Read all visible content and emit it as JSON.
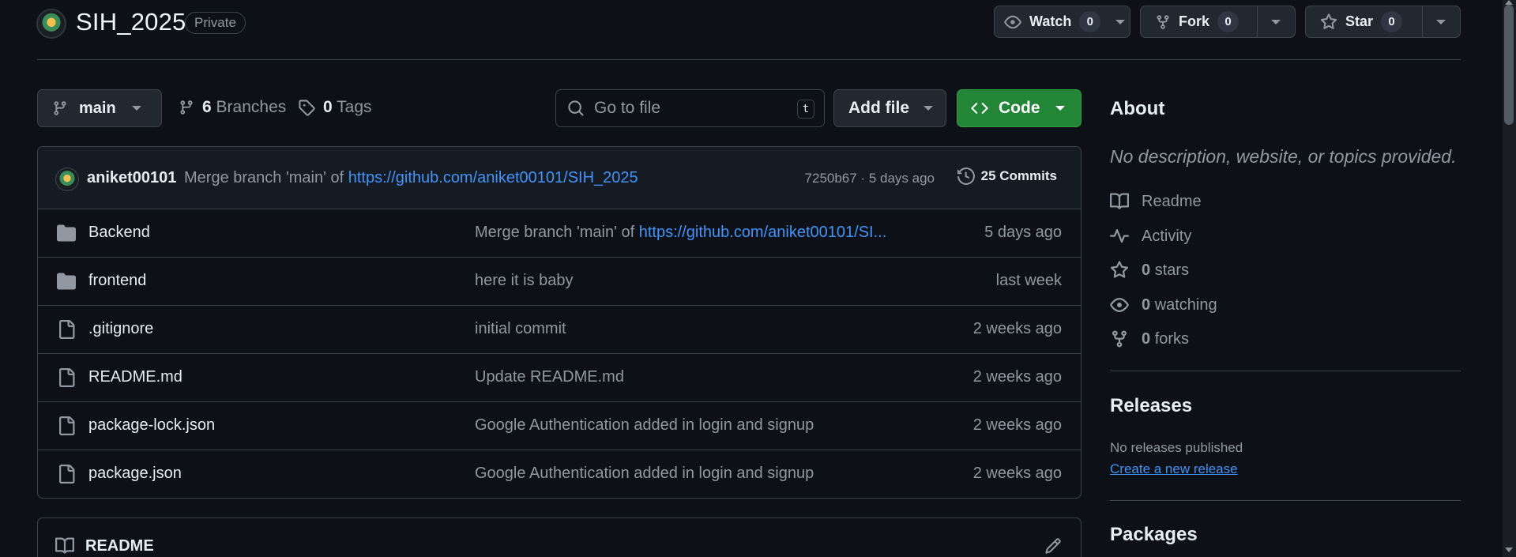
{
  "repo": {
    "name": "SIH_2025",
    "visibility": "Private"
  },
  "header": {
    "watch": {
      "label": "Watch",
      "count": "0"
    },
    "fork": {
      "label": "Fork",
      "count": "0"
    },
    "star": {
      "label": "Star",
      "count": "0"
    }
  },
  "toolbar": {
    "branch": "main",
    "branches_count": "6",
    "branches_label": "Branches",
    "tags_count": "0",
    "tags_label": "Tags",
    "goto_placeholder": "Go to file",
    "goto_shortcut": "t",
    "add_file_label": "Add file",
    "code_label": "Code"
  },
  "latest_commit": {
    "author": "aniket00101",
    "message_prefix": "Merge branch 'main' of ",
    "message_link": "https://github.com/aniket00101/SIH_2025",
    "sha_time": "7250b67 · 5 days ago",
    "commits_count": "25",
    "commits_label": "Commits"
  },
  "files": [
    {
      "type": "folder",
      "name": "Backend",
      "message": "Merge branch 'main' of ",
      "message_link": "https://github.com/aniket00101/SI...",
      "time": "5 days ago"
    },
    {
      "type": "folder",
      "name": "frontend",
      "message": "here it is baby",
      "message_link": "",
      "time": "last week"
    },
    {
      "type": "file",
      "name": ".gitignore",
      "message": "initial commit",
      "message_link": "",
      "time": "2 weeks ago"
    },
    {
      "type": "file",
      "name": "README.md",
      "message": "Update README.md",
      "message_link": "",
      "time": "2 weeks ago"
    },
    {
      "type": "file",
      "name": "package-lock.json",
      "message": "Google Authentication added in login and signup",
      "message_link": "",
      "time": "2 weeks ago"
    },
    {
      "type": "file",
      "name": "package.json",
      "message": "Google Authentication added in login and signup",
      "message_link": "",
      "time": "2 weeks ago"
    }
  ],
  "readme": {
    "title": "README"
  },
  "sidebar": {
    "about_title": "About",
    "about_desc": "No description, website, or topics provided.",
    "readme_label": "Readme",
    "activity_label": "Activity",
    "stars_count": "0",
    "stars_label": "stars",
    "watching_count": "0",
    "watching_label": "watching",
    "forks_count": "0",
    "forks_label": "forks",
    "releases_title": "Releases",
    "releases_none": "No releases published",
    "releases_link": "Create a new release",
    "packages_title": "Packages"
  },
  "colors": {
    "background": "#0d1117",
    "border": "#3d444d",
    "code_button": "#238636",
    "link": "#4493f8",
    "muted_text": "#9198a1"
  }
}
